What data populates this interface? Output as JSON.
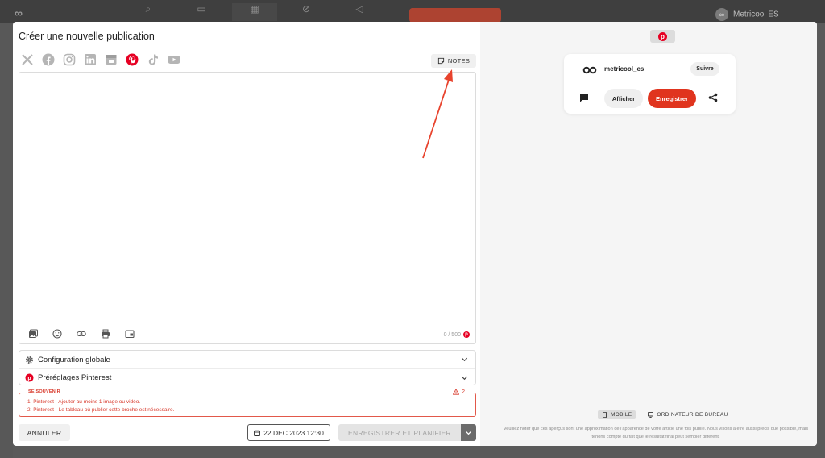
{
  "background": {
    "user_name": "Metricool ES",
    "nav_icons": [
      "search-icon",
      "chat-icon",
      "calendar-icon",
      "link-icon",
      "megaphone-icon"
    ]
  },
  "modal": {
    "title": "Créer une nouvelle publication",
    "socials": [
      {
        "name": "x-twitter",
        "icon": "x-icon",
        "color": "#b5b5b5"
      },
      {
        "name": "facebook",
        "icon": "facebook-icon",
        "color": "#b5b5b5"
      },
      {
        "name": "instagram",
        "icon": "instagram-icon",
        "color": "#b5b5b5"
      },
      {
        "name": "linkedin",
        "icon": "linkedin-icon",
        "color": "#b5b5b5"
      },
      {
        "name": "google-business",
        "icon": "store-icon",
        "color": "#b5b5b5"
      },
      {
        "name": "pinterest",
        "icon": "pinterest-icon",
        "color": "#e60023",
        "active": true
      },
      {
        "name": "tiktok",
        "icon": "tiktok-icon",
        "color": "#b5b5b5"
      },
      {
        "name": "youtube",
        "icon": "youtube-icon",
        "color": "#b5b5b5"
      }
    ],
    "notes_label": "NOTES",
    "editor": {
      "counter": "0 / 500"
    },
    "sections": {
      "global_config": "Configuration globale",
      "pinterest_presets": "Préréglages Pinterest"
    },
    "reminder": {
      "label": "SE SOUVENIR",
      "count": "2",
      "items": [
        "1. Pinterest - Ajouter au moins 1 image ou vidéo.",
        "2. Pinterest - Le tableau où publier cette broche est nécessaire."
      ]
    },
    "footer": {
      "cancel": "ANNULER",
      "date": "22 DEC 2023 12:30",
      "save_schedule": "ENREGISTRER ET PLANIFIER"
    }
  },
  "preview": {
    "account": "metricool_es",
    "follow": "Suivre",
    "show": "Afficher",
    "save": "Enregistrer",
    "mobile": "MOBILE",
    "desktop": "ORDINATEUR DE BUREAU",
    "disclaimer": "Veuillez noter que ces aperçus sont une approximation de l'apparence de votre article une fois publié. Nous visons à être aussi précis que possible, mais tenons compte du fait que le résultat final peut sembler différent."
  },
  "colors": {
    "pinterest": "#e60023",
    "accent_red": "#e0341e",
    "warning_red": "#d8392b"
  }
}
